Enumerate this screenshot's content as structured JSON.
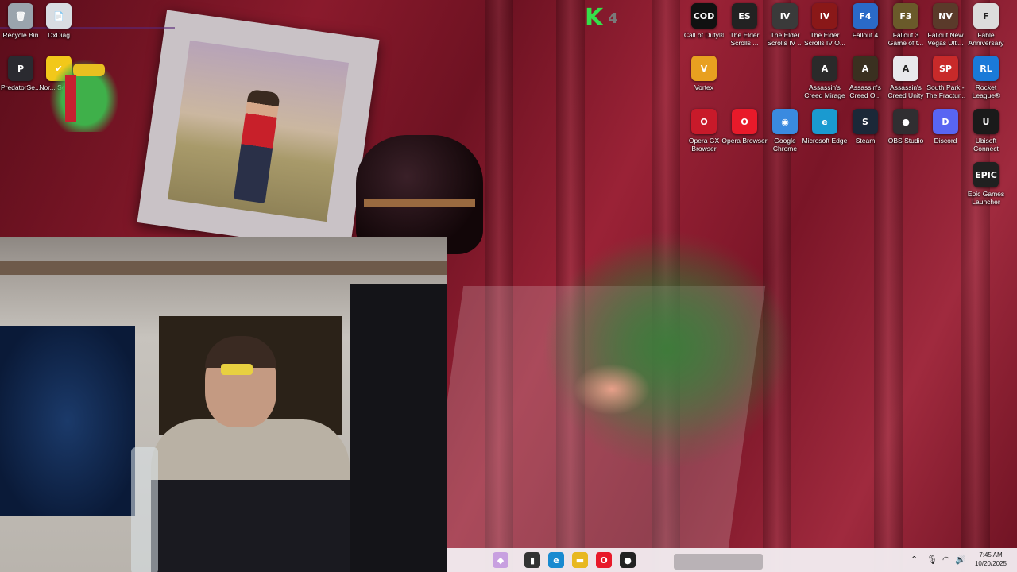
{
  "desktop": {
    "top_left_icons": [
      {
        "id": "recycle-bin",
        "label": "Recycle Bin",
        "glyph": "🗑",
        "color": "#9aa4ad"
      },
      {
        "id": "dxdiag",
        "label": "DxDiag",
        "glyph": "📄",
        "color": "#d8dde2"
      },
      {
        "id": "predatorsense",
        "label": "PredatorSe...",
        "glyph": "P",
        "color": "#2a2a30"
      },
      {
        "id": "norton",
        "label": "Nor... Secu...",
        "glyph": "✔",
        "color": "#f2c81a"
      }
    ],
    "right_icons": [
      {
        "id": "call-of-duty",
        "label": "Call of Duty®",
        "glyph": "COD",
        "color": "#111111"
      },
      {
        "id": "elder-scrolls-1",
        "label": "The Elder Scrolls ...",
        "glyph": "ES",
        "color": "#222222"
      },
      {
        "id": "elder-scrolls-iv",
        "label": "The Elder Scrolls IV ...",
        "glyph": "IV",
        "color": "#3a3a3a"
      },
      {
        "id": "elder-scrolls-iv-o",
        "label": "The Elder Scrolls IV O...",
        "glyph": "IV",
        "color": "#8a1818"
      },
      {
        "id": "fallout-4",
        "label": "Fallout 4",
        "glyph": "F4",
        "color": "#2a6ac8"
      },
      {
        "id": "fallout-3",
        "label": "Fallout 3 Game of t...",
        "glyph": "F3",
        "color": "#6a5a2a"
      },
      {
        "id": "fallout-nv",
        "label": "Fallout New Vegas Ulti...",
        "glyph": "NV",
        "color": "#5a3a2a"
      },
      {
        "id": "fable-anniversary",
        "label": "Fable Anniversary",
        "glyph": "F",
        "color": "#dcdcdc"
      },
      {
        "id": "vortex",
        "label": "Vortex",
        "glyph": "V",
        "color": "#e8a020"
      },
      {
        "id": "ac-mirage",
        "label": "Assassin's Creed Mirage",
        "glyph": "A",
        "color": "#2a2a2a"
      },
      {
        "id": "ac-odyssey",
        "label": "Assassin's Creed O...",
        "glyph": "A",
        "color": "#3a3020"
      },
      {
        "id": "ac-unity",
        "label": "Assassin's Creed Unity",
        "glyph": "A",
        "color": "#e8e8ec"
      },
      {
        "id": "south-park",
        "label": "South Park - The Fractur...",
        "glyph": "SP",
        "color": "#c82a2a"
      },
      {
        "id": "rocket-league",
        "label": "Rocket League®",
        "glyph": "RL",
        "color": "#1a7ad8"
      },
      {
        "id": "opera-gx",
        "label": "Opera GX Browser",
        "glyph": "O",
        "color": "#c81a2a"
      },
      {
        "id": "opera",
        "label": "Opera Browser",
        "glyph": "O",
        "color": "#e81a2a"
      },
      {
        "id": "chrome",
        "label": "Google Chrome",
        "glyph": "◉",
        "color": "#3a8ae0"
      },
      {
        "id": "edge",
        "label": "Microsoft Edge",
        "glyph": "e",
        "color": "#1a9ad0"
      },
      {
        "id": "steam",
        "label": "Steam",
        "glyph": "S",
        "color": "#1b2838"
      },
      {
        "id": "obs",
        "label": "OBS Studio",
        "glyph": "●",
        "color": "#302e31"
      },
      {
        "id": "discord",
        "label": "Discord",
        "glyph": "D",
        "color": "#5865f2"
      },
      {
        "id": "ubisoft",
        "label": "Ubisoft Connect",
        "glyph": "U",
        "color": "#1a1a1a"
      },
      {
        "id": "epic",
        "label": "Epic Games Launcher",
        "glyph": "EPIC",
        "color": "#202020"
      }
    ],
    "k_overlay": {
      "letter": "K",
      "number": "4"
    }
  },
  "taskbar": {
    "clock_time": "7:45 AM",
    "clock_date": "10/20/2025",
    "tray": {
      "chevron": "^",
      "mic": "🎙",
      "wifi": "◠",
      "speaker": "🔊"
    }
  }
}
